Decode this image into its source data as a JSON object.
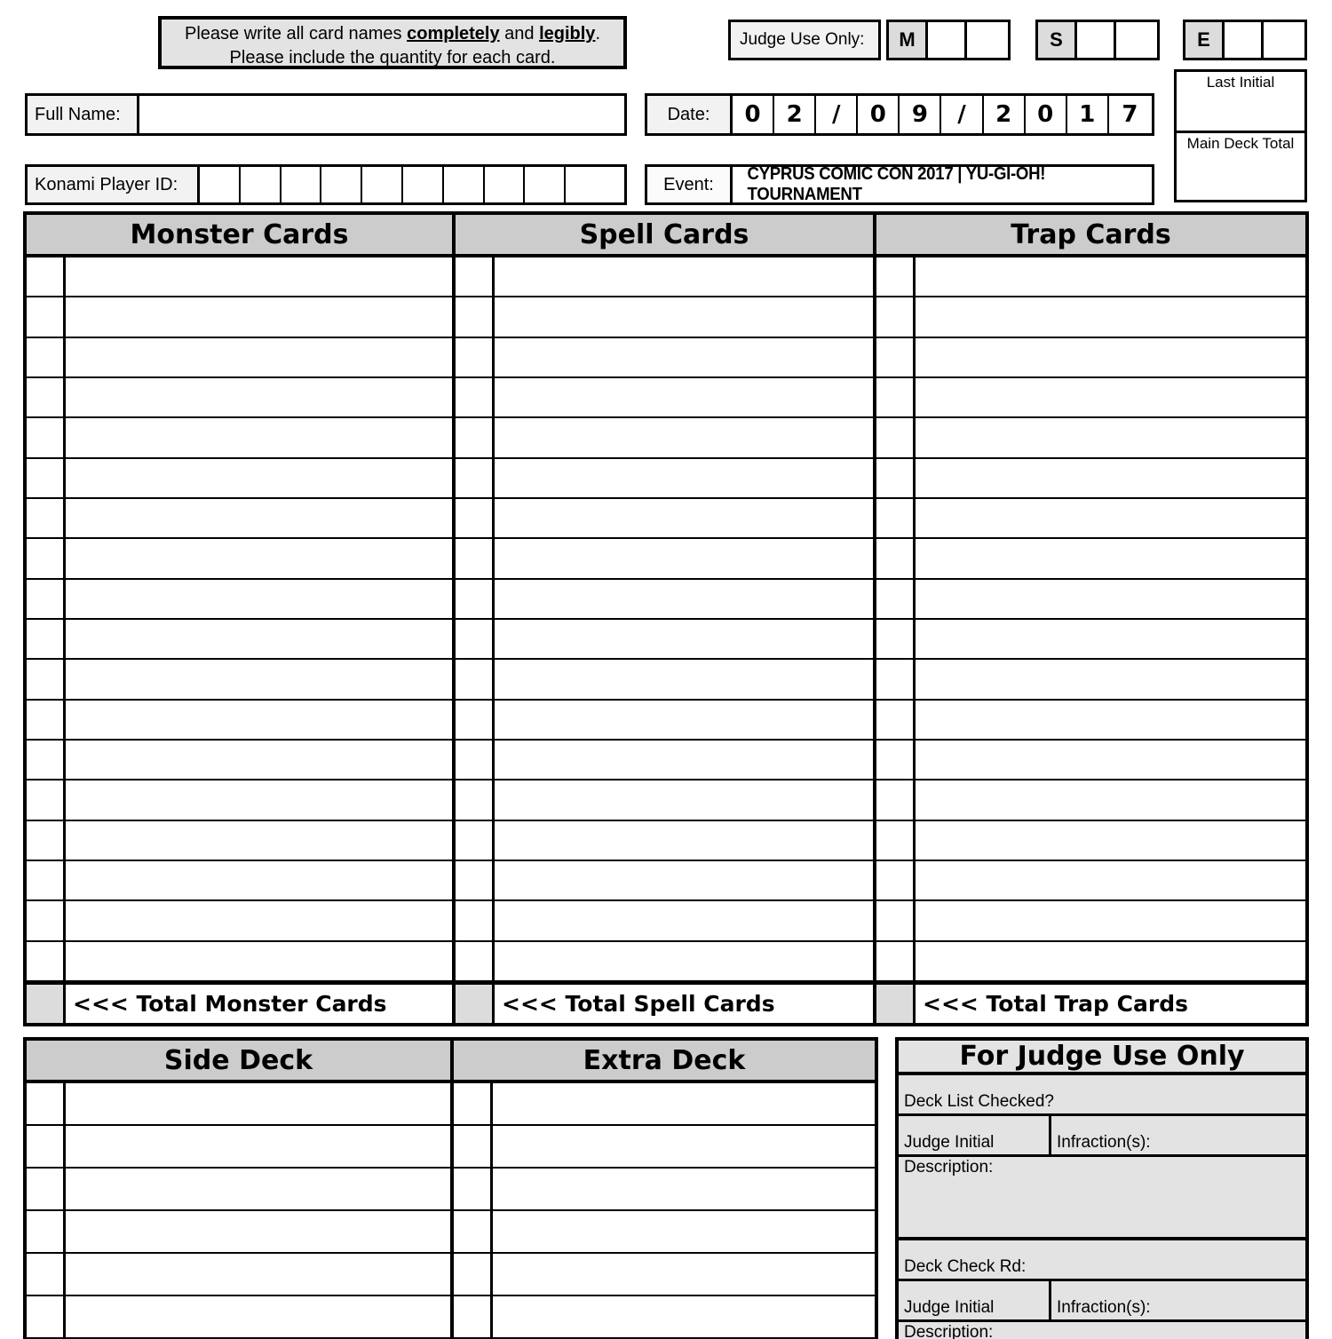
{
  "notice": {
    "line1_a": "Please write all card names ",
    "line1_b": "completely",
    "line1_c": " and ",
    "line1_d": "legibly",
    "line1_e": ".",
    "line2": "Please include the quantity for each card."
  },
  "judge_strip": {
    "label": "Judge Use Only:",
    "groups": [
      {
        "letter": "M",
        "cells": [
          "",
          ""
        ]
      },
      {
        "letter": "S",
        "cells": [
          "",
          ""
        ]
      },
      {
        "letter": "E",
        "cells": [
          "",
          ""
        ]
      }
    ]
  },
  "player": {
    "full_name_label": "Full Name:",
    "full_name_value": "",
    "konami_id_label": "Konami Player ID:",
    "konami_id_digits": [
      "",
      "",
      "",
      "",
      "",
      "",
      "",
      "",
      "",
      ""
    ]
  },
  "event_info": {
    "date_label": "Date:",
    "date_digits": [
      "0",
      "2",
      "/",
      "0",
      "9",
      "/",
      "2",
      "0",
      "1",
      "7"
    ],
    "event_label": "Event:",
    "event_value": "CYPRUS COMIC CON 2017 | YU-GI-OH! TOURNAMENT"
  },
  "side_boxes": {
    "last_initial_label": "Last Initial",
    "last_initial_value": "",
    "main_deck_total_label": "Main Deck Total",
    "main_deck_total_value": ""
  },
  "main_table": {
    "row_count": 18,
    "columns": [
      {
        "header": "Monster Cards",
        "total_label": "<<< Total Monster Cards",
        "total_value": ""
      },
      {
        "header": "Spell Cards",
        "total_label": "<<< Total Spell Cards",
        "total_value": ""
      },
      {
        "header": "Trap Cards",
        "total_label": "<<< Total Trap Cards",
        "total_value": ""
      }
    ]
  },
  "bottom_decks": {
    "row_count": 6,
    "columns": [
      {
        "header": "Side Deck"
      },
      {
        "header": "Extra Deck"
      }
    ]
  },
  "judge_panel": {
    "title": "For Judge Use Only",
    "blocks": [
      {
        "heading": "Deck List Checked?",
        "judge_initial_label": "Judge Initial",
        "infractions_label": "Infraction(s):",
        "description_label": "Description:"
      },
      {
        "heading": "Deck Check Rd:",
        "judge_initial_label": "Judge Initial",
        "infractions_label": "Infraction(s):",
        "description_label": "Description:"
      }
    ]
  },
  "colors": {
    "header_gray": "#cccccc",
    "panel_gray": "#e3e3e3",
    "label_gray": "#f2f2f2",
    "cell_gray": "#dcdcdc",
    "line": "#000000"
  }
}
